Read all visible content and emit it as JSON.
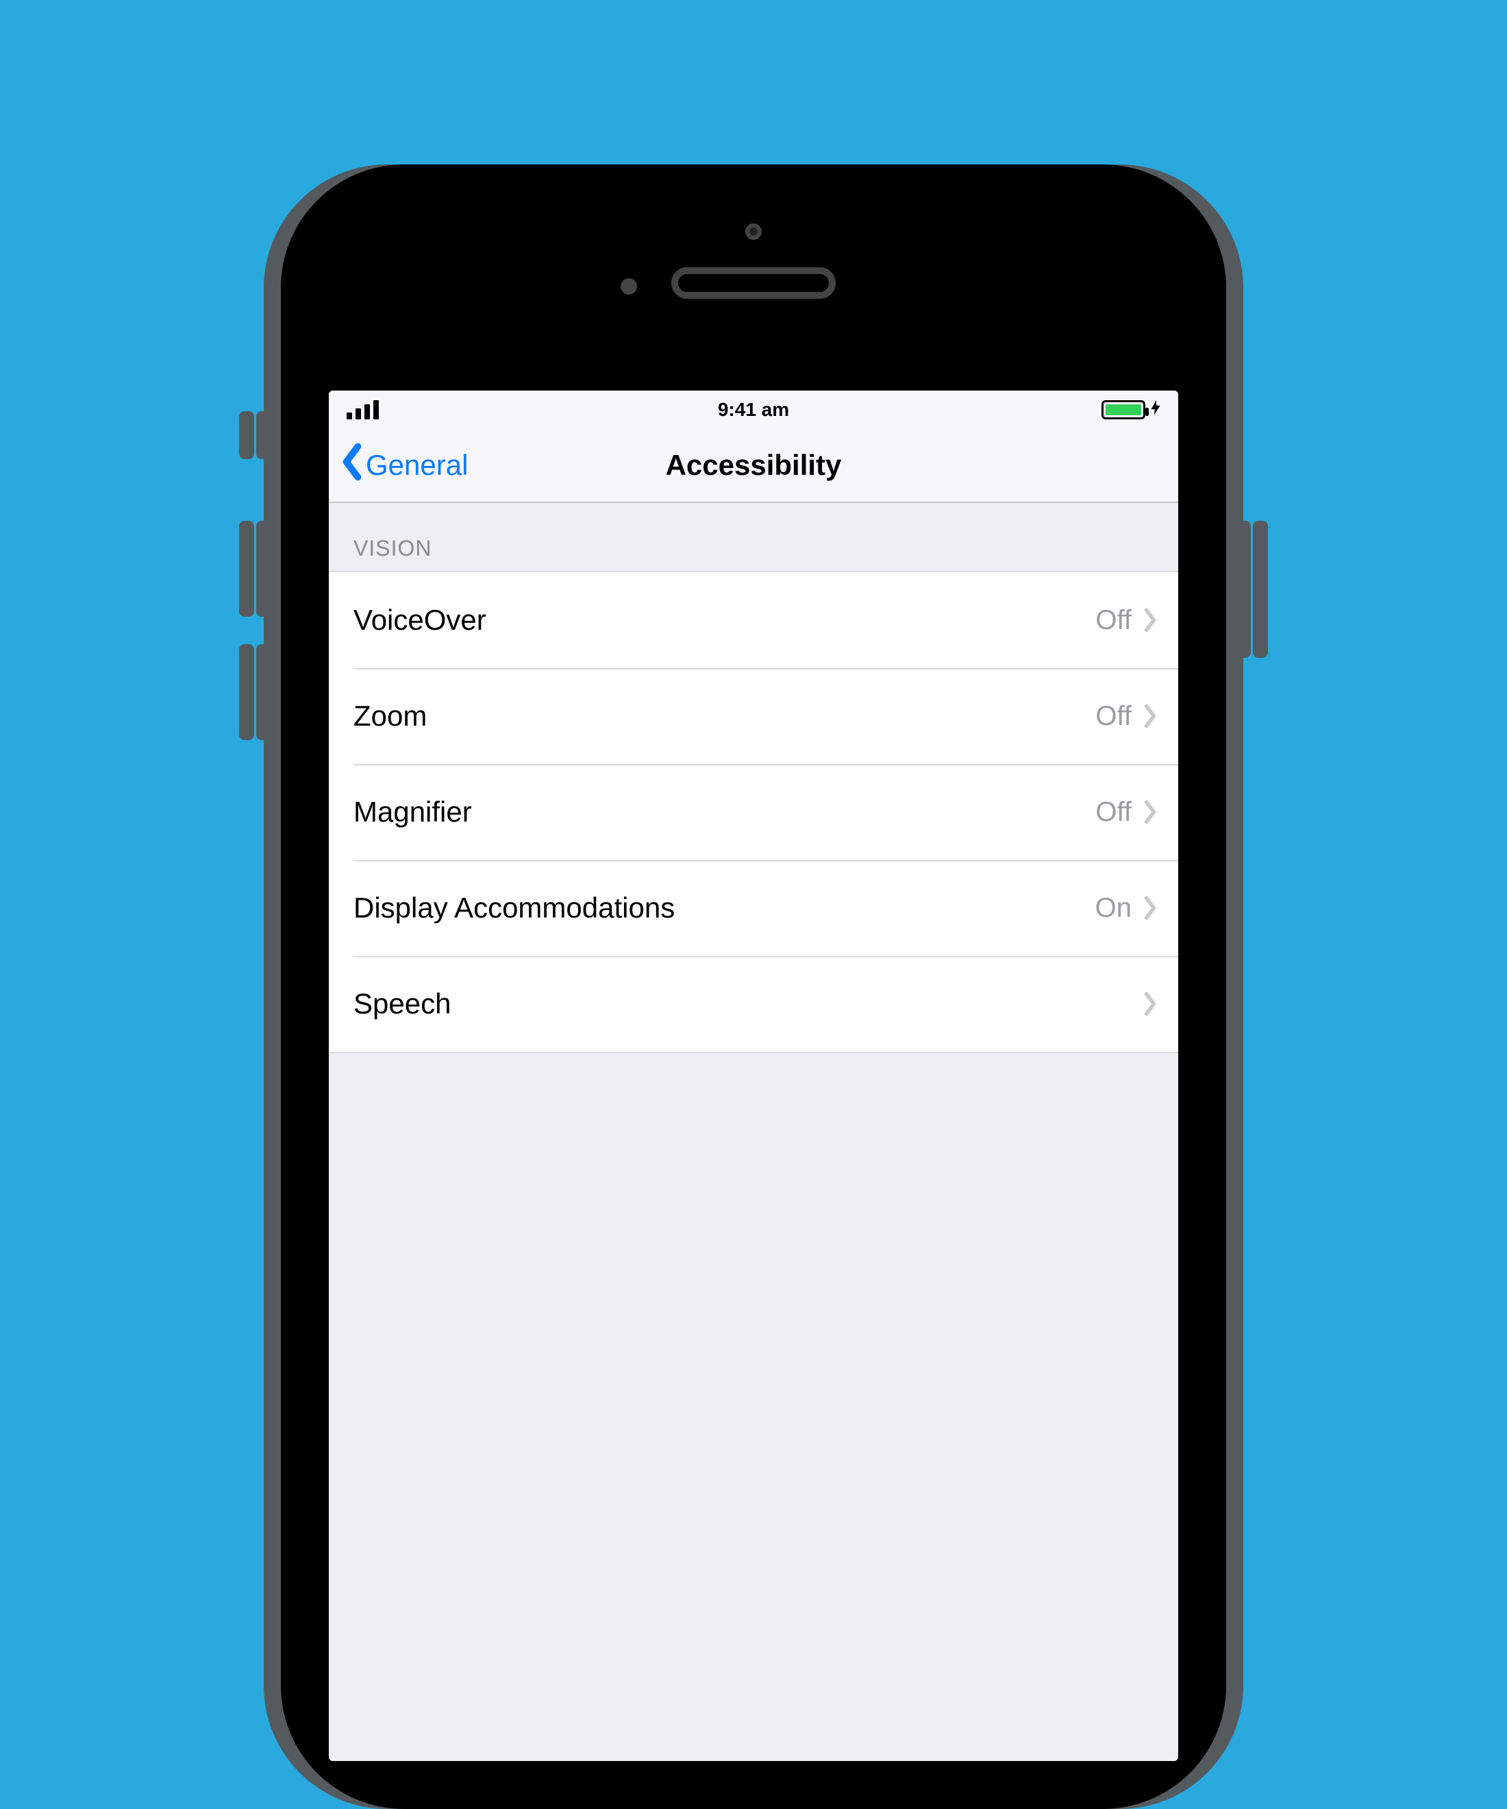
{
  "statusbar": {
    "time": "9:41 am"
  },
  "nav": {
    "back_label": "General",
    "title": "Accessibility"
  },
  "section": {
    "header": "VISION",
    "items": [
      {
        "label": "VoiceOver",
        "value": "Off"
      },
      {
        "label": "Zoom",
        "value": "Off"
      },
      {
        "label": "Magnifier",
        "value": "Off"
      },
      {
        "label": "Display Accommodations",
        "value": "On"
      },
      {
        "label": "Speech",
        "value": ""
      }
    ]
  }
}
